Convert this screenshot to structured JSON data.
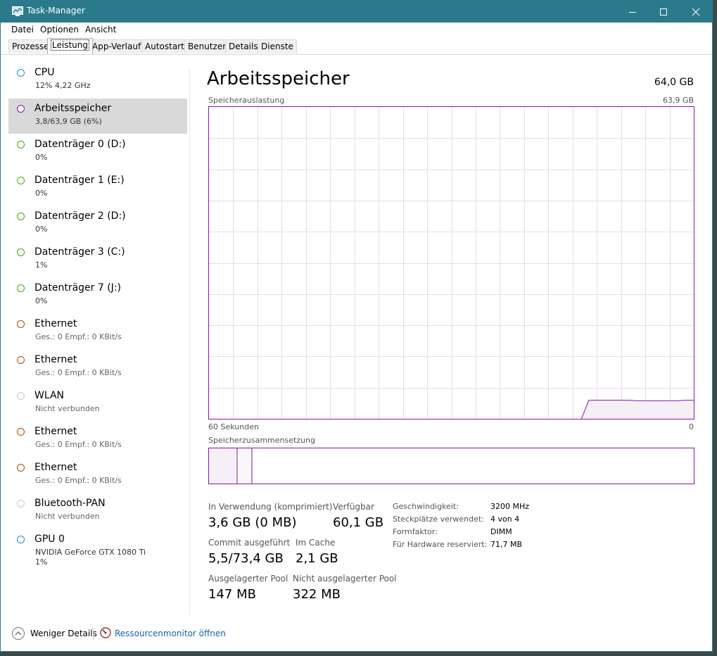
{
  "window": {
    "title": "Task-Manager",
    "colors": {
      "titlebar": "#2b7a8c",
      "memory_accent": "#8b12ae"
    }
  },
  "menu": [
    "Datei",
    "Optionen",
    "Ansicht"
  ],
  "tabs": [
    "Prozesse",
    "Leistung",
    "App-Verlauf",
    "Autostart",
    "Benutzer",
    "Details",
    "Dienste"
  ],
  "active_tab": "Leistung",
  "sidebar": {
    "items": [
      {
        "name": "CPU",
        "sub": "12%  4,22 GHz",
        "color": "#1c8fd6"
      },
      {
        "name": "Arbeitsspeicher",
        "sub": "3,8/63,9 GB (6%)",
        "color": "#8b12ae",
        "selected": true
      },
      {
        "name": "Datenträger 0 (D:)",
        "sub": "0%",
        "color": "#4da60c"
      },
      {
        "name": "Datenträger 1 (E:)",
        "sub": "0%",
        "color": "#4da60c"
      },
      {
        "name": "Datenträger 2 (D:)",
        "sub": "0%",
        "color": "#4da60c"
      },
      {
        "name": "Datenträger 3 (C:)",
        "sub": "1%",
        "color": "#4da60c"
      },
      {
        "name": "Datenträger 7 (J:)",
        "sub": "0%",
        "color": "#4da60c"
      },
      {
        "name": "Ethernet",
        "sub": "Ges.: 0 Empf.: 0 KBit/s",
        "color": "#a74f01"
      },
      {
        "name": "Ethernet",
        "sub": "Ges.: 0 Empf.: 0 KBit/s",
        "color": "#a74f01"
      },
      {
        "name": "WLAN",
        "sub": "Nicht verbunden",
        "color": "#c8c8c8"
      },
      {
        "name": "Ethernet",
        "sub": "Ges.: 0 Empf.: 0 KBit/s",
        "color": "#a74f01"
      },
      {
        "name": "Ethernet",
        "sub": "Ges.: 0 Empf.: 0 KBit/s",
        "color": "#a74f01"
      },
      {
        "name": "Bluetooth-PAN",
        "sub": "Nicht verbunden",
        "color": "#c8c8c8"
      },
      {
        "name": "GPU 0",
        "sub": "NVIDIA GeForce GTX 1080 Ti",
        "sub2": "1%",
        "color": "#1c8fd6"
      }
    ]
  },
  "main": {
    "title": "Arbeitsspeicher",
    "total": "64,0 GB",
    "usage_label": "Speicherauslastung",
    "usage_max": "63,9 GB",
    "time_left": "60 Sekunden",
    "time_right": "0",
    "composition_label": "Speicherzusammensetzung",
    "stats": {
      "in_use_label": "In Verwendung (komprimiert)",
      "in_use_value": "3,6 GB (0 MB)",
      "available_label": "Verfügbar",
      "available_value": "60,1 GB",
      "commit_label": "Commit ausgeführt",
      "commit_value": "5,5/73,4 GB",
      "cache_label": "Im Cache",
      "cache_value": "2,1 GB",
      "paged_label": "Ausgelagerter Pool",
      "paged_value": "147 MB",
      "nonpaged_label": "Nicht ausgelagerter Pool",
      "nonpaged_value": "322 MB"
    },
    "props": [
      {
        "label": "Geschwindigkeit:",
        "value": "3200 MHz"
      },
      {
        "label": "Steckplätze verwendet:",
        "value": "4 von 4"
      },
      {
        "label": "Formfaktor:",
        "value": "DIMM"
      },
      {
        "label": "Für Hardware reserviert:",
        "value": "71,7 MB"
      }
    ]
  },
  "chart_data": {
    "type": "area",
    "title": "Speicherauslastung",
    "xlabel": "",
    "ylabel": "",
    "ylim": [
      0,
      63.9
    ],
    "series": [
      {
        "values": [
          0,
          0,
          0,
          0,
          0,
          0,
          0,
          0,
          0,
          0,
          0,
          0,
          0,
          0,
          0,
          0,
          0,
          0,
          0,
          0,
          0,
          0,
          0,
          0,
          0,
          0,
          0,
          0,
          0,
          0,
          0,
          0,
          0,
          0,
          0,
          0,
          0,
          0,
          0,
          0,
          0,
          0,
          0,
          0,
          0,
          0,
          0,
          3.8,
          3.8,
          3.8,
          3.8,
          3.8,
          3.8,
          3.7,
          3.7,
          3.7,
          3.7,
          3.7,
          3.7,
          3.8,
          3.8
        ]
      }
    ]
  },
  "footer": {
    "less_details": "Weniger Details",
    "resource_monitor": "Ressourcenmonitor öffnen"
  }
}
